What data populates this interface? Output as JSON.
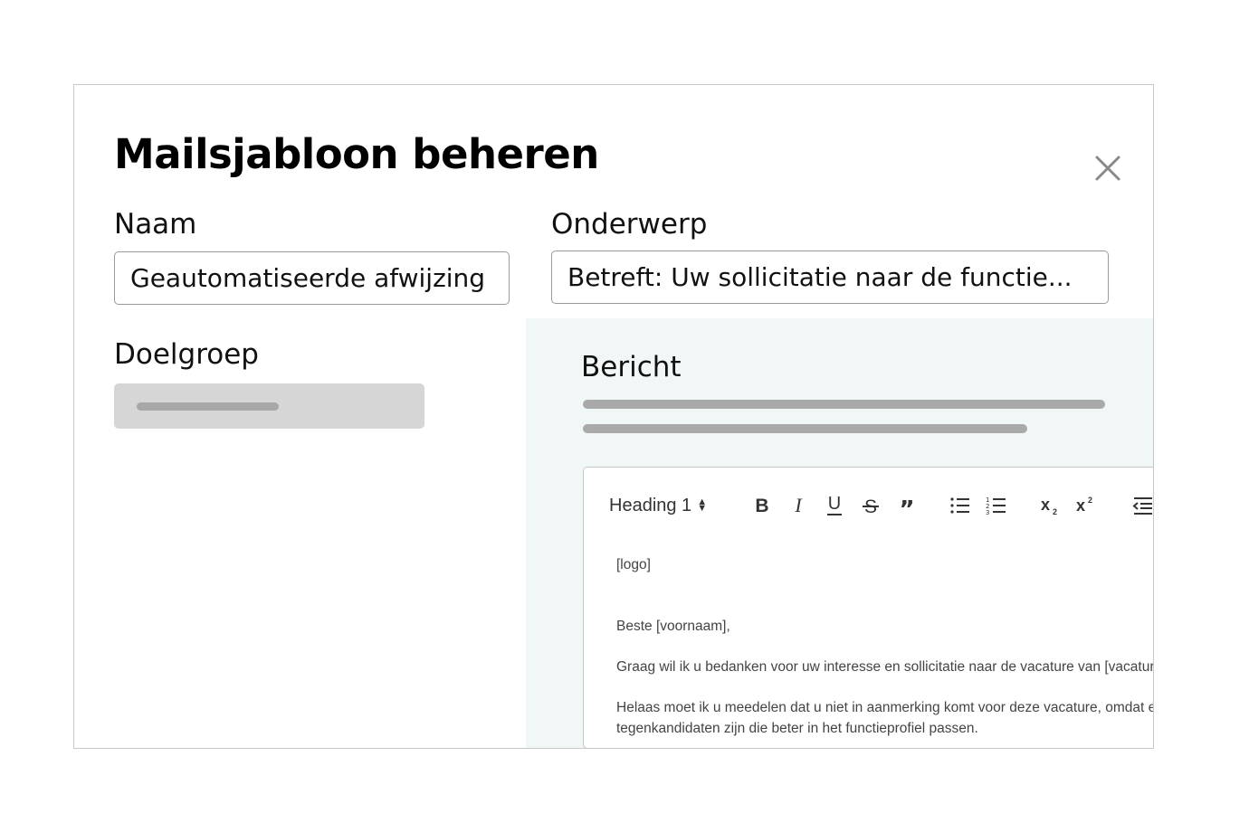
{
  "modal": {
    "title": "Mailsjabloon beheren",
    "close_icon": "close-icon"
  },
  "form": {
    "naam": {
      "label": "Naam",
      "value": "Geautomatiseerde afwijzing"
    },
    "onderwerp": {
      "label": "Onderwerp",
      "value": "Betreft: Uw sollicitatie naar de functie..."
    },
    "doelgroep": {
      "label": "Doelgroep",
      "value": ""
    }
  },
  "bericht": {
    "label": "Bericht",
    "toolbar": {
      "heading_select": "Heading 1",
      "buttons": [
        {
          "name": "bold",
          "icon": "bold-icon"
        },
        {
          "name": "italic",
          "icon": "italic-icon"
        },
        {
          "name": "underline",
          "icon": "underline-icon"
        },
        {
          "name": "strikethrough",
          "icon": "strikethrough-icon"
        },
        {
          "name": "blockquote",
          "icon": "quote-icon"
        },
        {
          "name": "bullet-list",
          "icon": "bullet-list-icon"
        },
        {
          "name": "numbered-list",
          "icon": "numbered-list-icon"
        },
        {
          "name": "subscript",
          "icon": "subscript-icon"
        },
        {
          "name": "superscript",
          "icon": "superscript-icon"
        },
        {
          "name": "outdent",
          "icon": "outdent-icon"
        }
      ]
    },
    "content": {
      "logo_placeholder": "[logo]",
      "greeting": "Beste [voornaam],",
      "paragraph1": "Graag wil ik u bedanken voor uw interesse en sollicitatie naar de vacature van [vacature]",
      "paragraph2_line1": "Helaas moet ik u meedelen dat u niet in aanmerking komt voor deze vacature, omdat er",
      "paragraph2_line2": "tegenkandidaten zijn die beter in het functieprofiel passen."
    }
  },
  "colors": {
    "panel_background": "#f1f7f7",
    "skeleton_fill": "#d6d6d6",
    "skeleton_bar": "#a8a8a8",
    "input_border": "#9a9a9a"
  }
}
